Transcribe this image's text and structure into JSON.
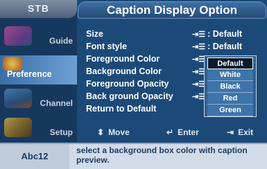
{
  "sidebar": {
    "tab_label": "STB",
    "items": [
      {
        "label": "Guide"
      },
      {
        "label": "Preference"
      },
      {
        "label": "Channel"
      },
      {
        "label": "Setup"
      }
    ]
  },
  "title": "Caption Display Option",
  "menu": {
    "rows": [
      {
        "name": "Size",
        "value": ": Default"
      },
      {
        "name": "Font style",
        "value": ": Default"
      },
      {
        "name": "Foreground Color",
        "value": ":"
      },
      {
        "name": "Background Color",
        "value": ":"
      },
      {
        "name": "Foreground Opacity",
        "value": ":"
      },
      {
        "name": "Back ground Opacity",
        "value": ":"
      },
      {
        "name": "Return to Default",
        "value": ""
      }
    ]
  },
  "dropdown": {
    "options": [
      "Default",
      "White",
      "Black",
      "Red",
      "Green"
    ],
    "selected": "Default"
  },
  "navbar": {
    "move": "Move",
    "enter": "Enter",
    "exit": "Exit"
  },
  "info": {
    "preview": "Abc12",
    "text": "select a background box color with caption preview."
  },
  "colors": {
    "background": "#1c4a78",
    "accent": "#6da0d4"
  }
}
